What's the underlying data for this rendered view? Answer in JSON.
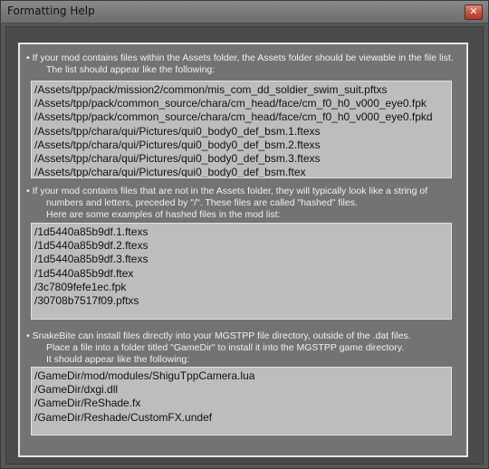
{
  "window": {
    "title": "Formatting Help",
    "close_label": "✕"
  },
  "sections": [
    {
      "lines": [
        "• If your mod contains files within the Assets folder, the Assets folder should be viewable in the file list.",
        "The list should appear like the following:"
      ],
      "examples": [
        "/Assets/tpp/pack/mission2/common/mis_com_dd_soldier_swim_suit.pftxs",
        "/Assets/tpp/pack/common_source/chara/cm_head/face/cm_f0_h0_v000_eye0.fpk",
        "/Assets/tpp/pack/common_source/chara/cm_head/face/cm_f0_h0_v000_eye0.fpkd",
        "/Assets/tpp/chara/qui/Pictures/qui0_body0_def_bsm.1.ftexs",
        "/Assets/tpp/chara/qui/Pictures/qui0_body0_def_bsm.2.ftexs",
        "/Assets/tpp/chara/qui/Pictures/qui0_body0_def_bsm.3.ftexs",
        "/Assets/tpp/chara/qui/Pictures/qui0_body0_def_bsm.ftex"
      ]
    },
    {
      "lines": [
        "• If your mod contains files that are not in the Assets folder, they will typically look like a string of",
        "numbers and letters, preceded by \"/\". These files are called \"hashed\" files.",
        "Here are some examples of hashed files in the mod list:"
      ],
      "examples": [
        "/1d5440a85b9df.1.ftexs",
        "/1d5440a85b9df.2.ftexs",
        "/1d5440a85b9df.3.ftexs",
        "/1d5440a85b9df.ftex",
        "/3c7809fefe1ec.fpk",
        "/30708b7517f09.pftxs"
      ]
    },
    {
      "lines": [
        "• SnakeBite can install files directly into your MGSTPP file directory, outside of the .dat files.",
        "Place a file into a folder titled \"GameDir\" to install it into the MGSTPP game directory.",
        "It should appear like the following:"
      ],
      "examples": [
        "/GameDir/mod/modules/ShiguTppCamera.lua",
        "/GameDir/dxgi.dll",
        "/GameDir/ReShade.fx",
        "/GameDir/Reshade/CustomFX.undef"
      ]
    }
  ]
}
